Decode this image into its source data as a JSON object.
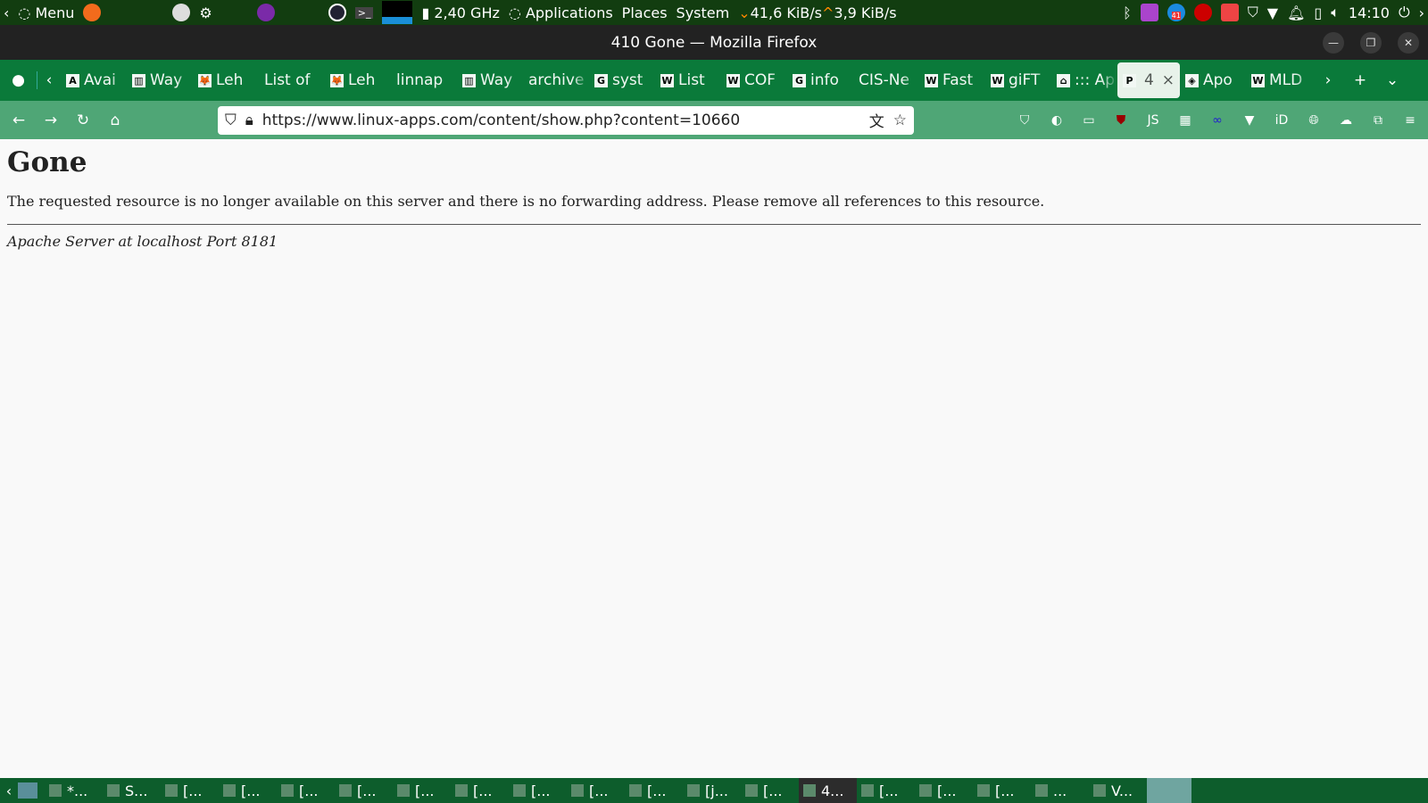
{
  "panel": {
    "menu": "Menu",
    "cpu": "2,40 GHz",
    "applications": "Applications",
    "places": "Places",
    "system": "System",
    "down": "41,6 KiB/s",
    "up": "3,9 KiB/s",
    "badge": "41",
    "clock": "14:10"
  },
  "window": {
    "title": "410 Gone — Mozilla Firefox"
  },
  "tabs": [
    {
      "label": "Avai",
      "icon": "A"
    },
    {
      "label": "Way",
      "icon": "▥"
    },
    {
      "label": "Leh",
      "icon": "🦊"
    },
    {
      "label": "List of",
      "icon": ""
    },
    {
      "label": "Leh",
      "icon": "🦊"
    },
    {
      "label": "linnap",
      "icon": ""
    },
    {
      "label": "Way",
      "icon": "▥"
    },
    {
      "label": "archive",
      "icon": ""
    },
    {
      "label": "syst",
      "icon": "G"
    },
    {
      "label": "List",
      "icon": "W"
    },
    {
      "label": "COF",
      "icon": "W"
    },
    {
      "label": "info",
      "icon": "G"
    },
    {
      "label": "CIS-Ne",
      "icon": ""
    },
    {
      "label": "Fast",
      "icon": "W"
    },
    {
      "label": "giFT",
      "icon": "W"
    },
    {
      "label": "::: Ap",
      "icon": "⌂"
    },
    {
      "label": "4",
      "icon": "P",
      "active": true
    },
    {
      "label": "Apo",
      "icon": "◈"
    },
    {
      "label": "MLD",
      "icon": "W"
    }
  ],
  "nav": {
    "url": "https://www.linux-apps.com/content/show.php?content=10660"
  },
  "page": {
    "heading": "Gone",
    "message": "The requested resource is no longer available on this server and there is no forwarding address. Please remove all references to this resource.",
    "address": "Apache Server at localhost Port 8181"
  },
  "taskbar": [
    "*...",
    "S...",
    "[...",
    "[...",
    "[...",
    "[...",
    "[...",
    "[...",
    "[...",
    "[...",
    "[...",
    "[j...",
    "[...",
    "4...",
    "[...",
    "[...",
    "[...",
    "...",
    "V..."
  ]
}
